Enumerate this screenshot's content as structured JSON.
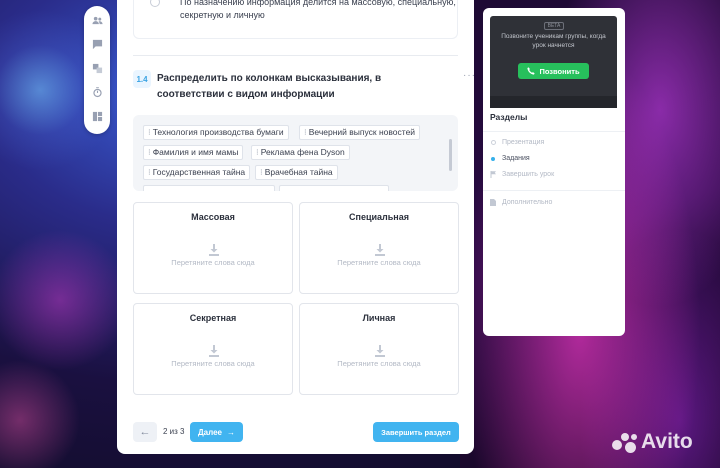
{
  "prev_option": {
    "text": "По назначению информация делится на массовую, специальную, секретную и личную"
  },
  "question": {
    "number": "1.4",
    "title": "Распределить по колонкам высказывания, в соответствии с видом информации",
    "more": "···"
  },
  "word_bank": [
    "Технология производства бумаги",
    "Вечерний выпуск новостей",
    "Фамилия и имя мамы",
    "Реклама фена Dyson",
    "Государственная тайна",
    "Врачебная тайна"
  ],
  "columns": [
    {
      "title": "Массовая",
      "hint": "Перетяните слова сюда"
    },
    {
      "title": "Специальная",
      "hint": "Перетяните слова сюда"
    },
    {
      "title": "Секретная",
      "hint": "Перетяните слова сюда"
    },
    {
      "title": "Личная",
      "hint": "Перетяните слова сюда"
    }
  ],
  "nav": {
    "back_icon": "←",
    "page_counter": "2 из 3",
    "next_label": "Далее",
    "next_icon": "→",
    "finish_label": "Завершить раздел"
  },
  "sidebar": {
    "video": {
      "badge": "BETA",
      "text": "Позвоните ученикам группы, когда урок начнется",
      "call_label": "Позвонить"
    },
    "sections_title": "Разделы",
    "sections": [
      {
        "label": "Презентация",
        "state": "inactive"
      },
      {
        "label": "Задания",
        "state": "active"
      },
      {
        "label": "Завершить урок",
        "state": "flag"
      }
    ],
    "extra": "Дополнительно"
  },
  "watermark": "Avito",
  "accent_color": "#41b4f0",
  "call_color": "#27c05c"
}
